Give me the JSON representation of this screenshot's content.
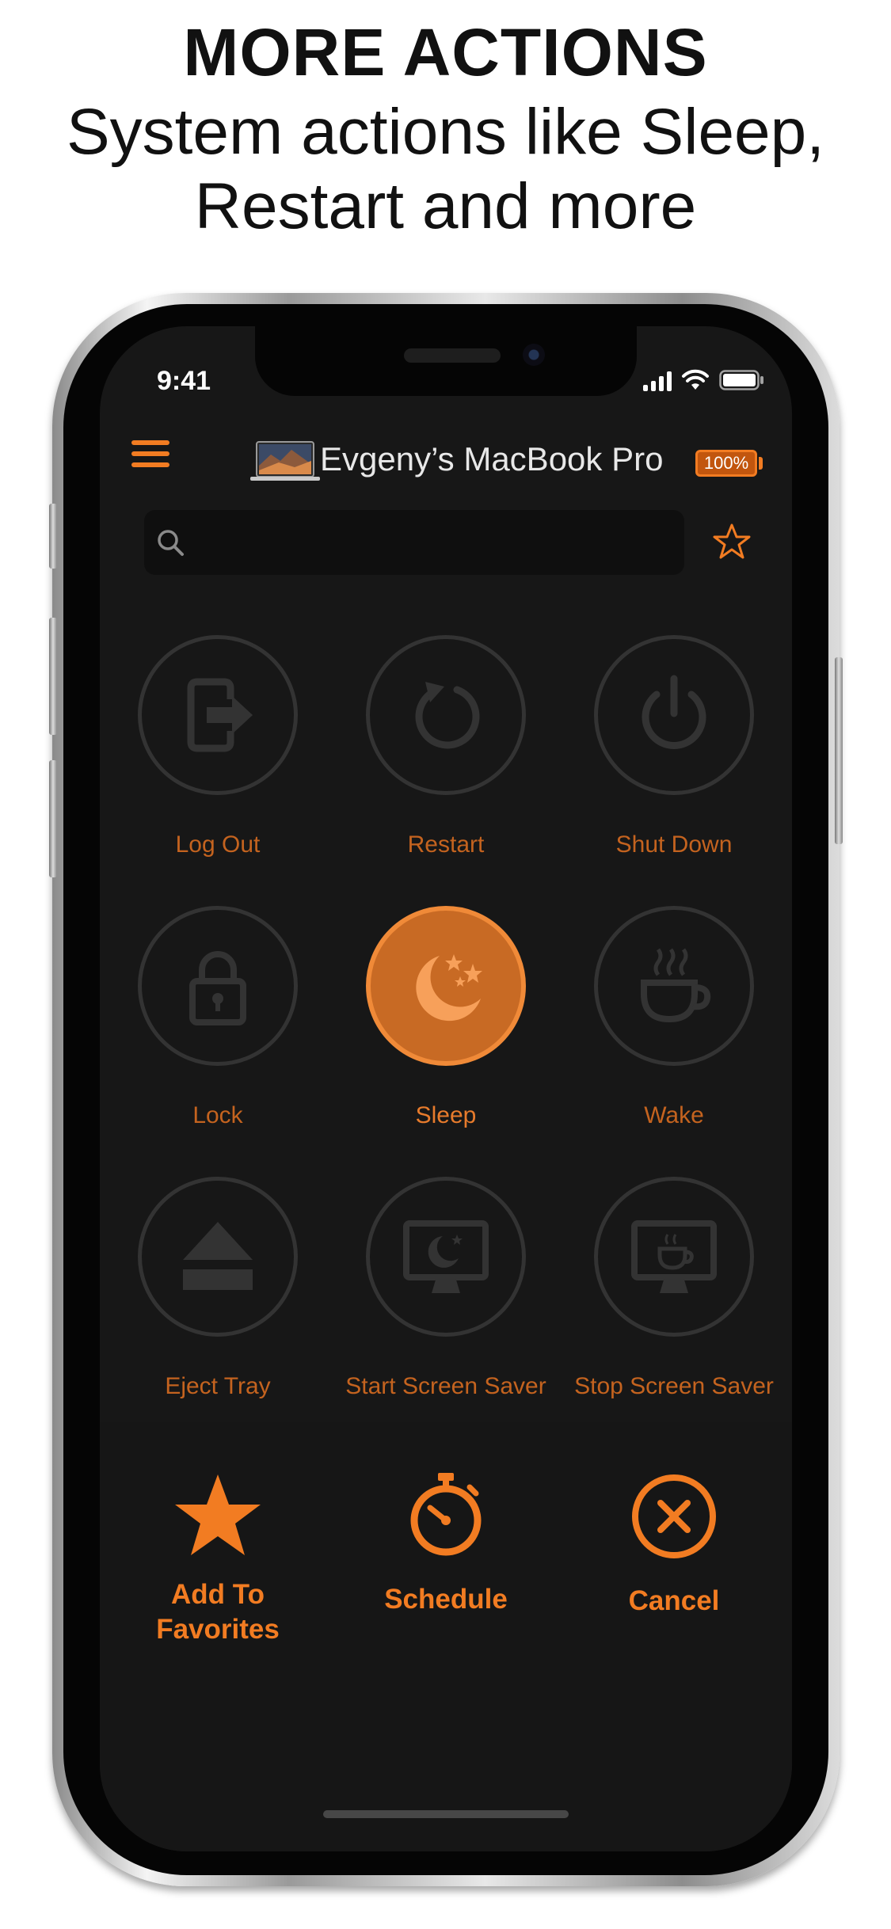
{
  "promo": {
    "headline": "MORE ACTIONS",
    "subline_1": "System actions like Sleep,",
    "subline_2": "Restart and more"
  },
  "status_bar": {
    "time": "9:41"
  },
  "header": {
    "device_name": "Evgeny’s MacBook Pro",
    "battery": "100%"
  },
  "search": {
    "value": "",
    "placeholder": ""
  },
  "actions": [
    {
      "label": "Log Out",
      "icon": "logout-icon"
    },
    {
      "label": "Restart",
      "icon": "restart-icon"
    },
    {
      "label": "Shut Down",
      "icon": "power-icon"
    },
    {
      "label": "Lock",
      "icon": "lock-icon"
    },
    {
      "label": "Sleep",
      "icon": "moon-stars-icon",
      "selected": true
    },
    {
      "label": "Wake",
      "icon": "coffee-cup-icon"
    },
    {
      "label": "Eject Tray",
      "icon": "eject-icon"
    },
    {
      "label": "Start Screen Saver",
      "icon": "monitor-moon-icon"
    },
    {
      "label": "Stop Screen Saver",
      "icon": "monitor-coffee-icon"
    }
  ],
  "sheet": {
    "favorites_line1": "Add To",
    "favorites_line2": "Favorites",
    "schedule": "Schedule",
    "cancel": "Cancel"
  },
  "colors": {
    "accent": "#f27c22",
    "background": "#171717",
    "inactive_ring": "#333333",
    "selected_fill": "#c86a24"
  }
}
